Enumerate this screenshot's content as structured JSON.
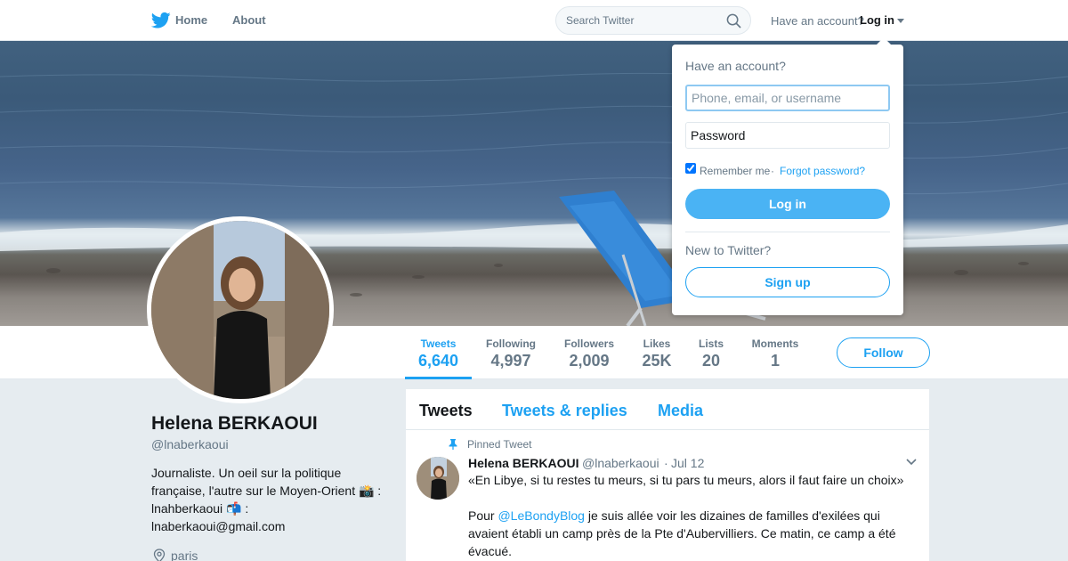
{
  "nav": {
    "logo_icon": "twitter-bird-icon",
    "home_label": "Home",
    "about_label": "About",
    "search_placeholder": "Search Twitter",
    "have_account_text": "Have an account?",
    "login_label": "Log in"
  },
  "profile": {
    "name": "Helena BERKAOUI",
    "handle": "@lnaberkaoui",
    "bio": "Journaliste. Un oeil sur la politique française, l'autre sur le Moyen-Orient 📸 : lnahberkaoui 📬 : lnaberkaoui@gmail.com",
    "location": "paris",
    "follow_label": "Follow"
  },
  "stats": [
    {
      "label": "Tweets",
      "value": "6,640"
    },
    {
      "label": "Following",
      "value": "4,997"
    },
    {
      "label": "Followers",
      "value": "2,009"
    },
    {
      "label": "Likes",
      "value": "25K"
    },
    {
      "label": "Lists",
      "value": "20"
    },
    {
      "label": "Moments",
      "value": "1"
    }
  ],
  "timeline": {
    "tabs": [
      "Tweets",
      "Tweets & replies",
      "Media"
    ],
    "pinned_label": "Pinned Tweet",
    "tweet": {
      "author": "Helena BERKAOUI",
      "handle": "@lnaberkaoui",
      "separator": "·",
      "date": "Jul 12",
      "line1": "«En Libye,  si tu restes tu meurs, si tu pars tu meurs, alors il faut faire un choix»",
      "line2_prefix": "Pour ",
      "line2_mention": "@LeBondyBlog",
      "line2_suffix": " je suis allée voir les dizaines de familles d'exilées qui avaient établi un camp près de la Pte d'Aubervilliers. Ce matin, ce camp a été évacué."
    }
  },
  "login_dropdown": {
    "title": "Have an account?",
    "username_placeholder": "Phone, email, or username",
    "password_placeholder": "Password",
    "remember_label": "Remember me",
    "separator": "·",
    "forgot_label": "Forgot password?",
    "login_button": "Log in",
    "new_text": "New to Twitter?",
    "signup_button": "Sign up"
  },
  "colors": {
    "accent": "#1da1f2",
    "login_button": "#4ab3f4",
    "text_primary": "#14171a",
    "text_secondary": "#657786",
    "page_background": "#e6ecf0"
  }
}
